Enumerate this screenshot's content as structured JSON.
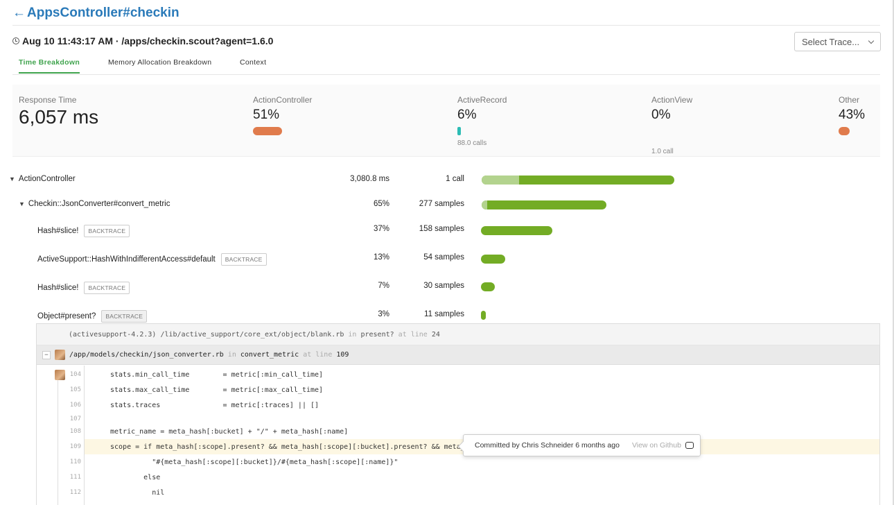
{
  "page": {
    "title": "AppsController#checkin",
    "subtitle": "Aug 10 11:43:17 AM · /apps/checkin.scout?agent=1.6.0",
    "select_trace": "Select Trace..."
  },
  "tabs": [
    "Time Breakdown",
    "Memory Allocation Breakdown",
    "Context"
  ],
  "summary": {
    "response_label": "Response Time",
    "response_value": "6,057 ms",
    "metrics": [
      {
        "label": "ActionController",
        "pct": "51%",
        "calls": "",
        "color": "#e07b4c"
      },
      {
        "label": "ActiveRecord",
        "pct": "6%",
        "calls": "88.0 calls",
        "color": "#2cbcb4"
      },
      {
        "label": "ActionView",
        "pct": "0%",
        "calls": "1.0 call",
        "color": ""
      },
      {
        "label": "Other",
        "pct": "43%",
        "calls": "",
        "color": "#e07b4c"
      }
    ]
  },
  "rows": [
    {
      "name": "ActionController",
      "value": "3,080.8 ms",
      "samples": "1 call",
      "backtrace": ""
    },
    {
      "name": "Checkin::JsonConverter#convert_metric",
      "value": "65%",
      "samples": "277 samples",
      "backtrace": ""
    },
    {
      "name": "Hash#slice!",
      "value": "37%",
      "samples": "158 samples",
      "backtrace": "BACKTRACE"
    },
    {
      "name": "ActiveSupport::HashWithIndifferentAccess#default",
      "value": "13%",
      "samples": "54 samples",
      "backtrace": "BACKTRACE"
    },
    {
      "name": "Hash#slice!",
      "value": "7%",
      "samples": "30 samples",
      "backtrace": "BACKTRACE"
    },
    {
      "name": "Object#present?",
      "value": "3%",
      "samples": "11 samples",
      "backtrace": "BACKTRACE"
    }
  ],
  "backtrace": {
    "frame1": {
      "path": "(activesupport-4.2.3) /lib/active_support/core_ext/object/blank.rb",
      "in": "in",
      "method": "present?",
      "at": "at line",
      "line": "24"
    },
    "frame2": {
      "path": "/app/models/checkin/json_converter.rb",
      "in": "in",
      "method": "convert_metric",
      "at": "at line",
      "line": "109"
    },
    "lines": [
      {
        "n": "104",
        "code": "stats.min_call_time        = metric[:min_call_time]"
      },
      {
        "n": "105",
        "code": "stats.max_call_time        = metric[:max_call_time]"
      },
      {
        "n": "106",
        "code": "stats.traces               = metric[:traces] || []"
      },
      {
        "n": "107",
        "code": ""
      },
      {
        "n": "108",
        "code": "metric_name = meta_hash[:bucket] + \"/\" + meta_hash[:name]"
      },
      {
        "n": "109",
        "code": "scope = if meta_hash[:scope].present? && meta_hash[:scope][:bucket].present? && meta_has"
      },
      {
        "n": "110",
        "code": "          \"#{meta_hash[:scope][:bucket]}/#{meta_hash[:scope][:name]}\""
      },
      {
        "n": "111",
        "code": "        else"
      },
      {
        "n": "112",
        "code": "          nil"
      }
    ]
  },
  "tooltip": {
    "commit": "Committed by Chris Schneider 6 months ago",
    "link": "View on Github"
  }
}
